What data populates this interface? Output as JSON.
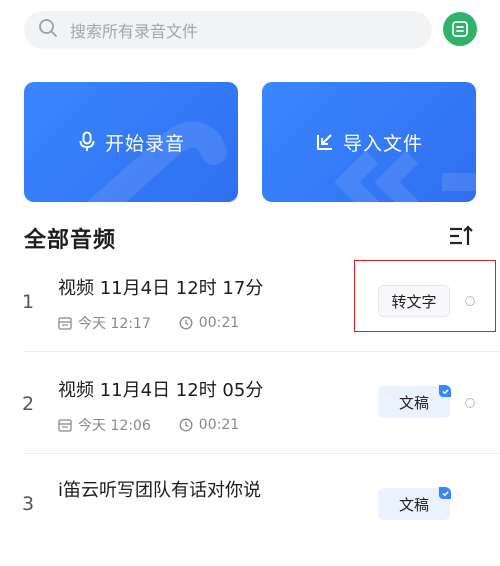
{
  "search": {
    "placeholder": "搜索所有录音文件"
  },
  "actions": {
    "record_label": "开始录音",
    "import_label": "导入文件"
  },
  "section": {
    "title": "全部音频"
  },
  "recordings": [
    {
      "index": "1",
      "title": "视频 11月4日 12时 17分",
      "date": "今天 12:17",
      "duration": "00:21",
      "action": "转文字"
    },
    {
      "index": "2",
      "title": "视频 11月4日 12时 05分",
      "date": "今天 12:06",
      "duration": "00:21",
      "action": "文稿"
    },
    {
      "index": "3",
      "title": "i笛云听写团队有话对你说",
      "action": "文稿"
    }
  ],
  "colors": {
    "accent": "#3a86ff",
    "menu": "#2fb36b",
    "highlight": "#e02020"
  }
}
